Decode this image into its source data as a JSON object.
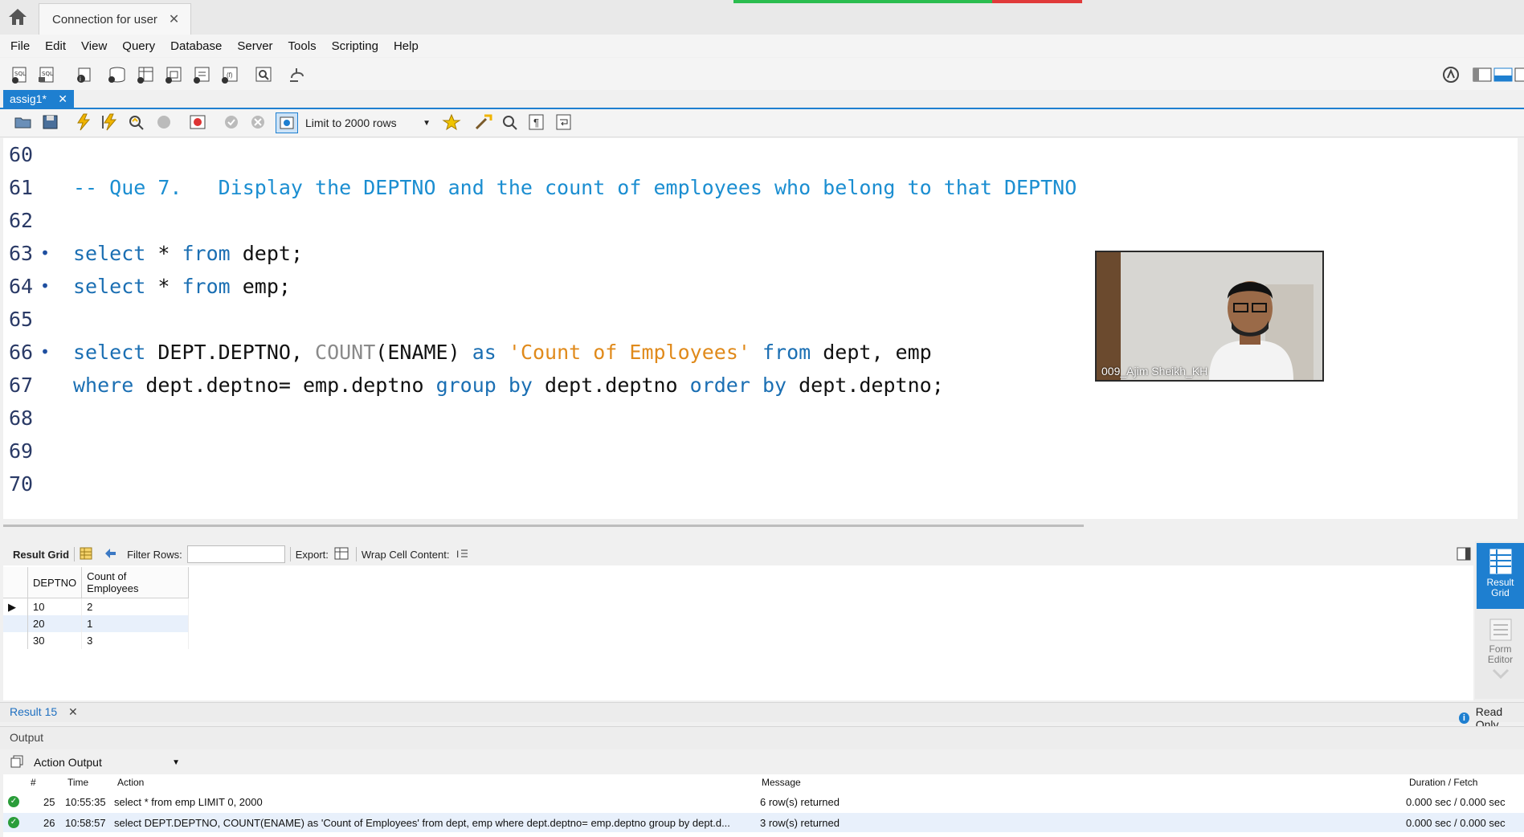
{
  "tabs": {
    "connection": "Connection for user",
    "file": "assig1*"
  },
  "menu": [
    "File",
    "Edit",
    "View",
    "Query",
    "Database",
    "Server",
    "Tools",
    "Scripting",
    "Help"
  ],
  "editor_toolbar": {
    "limit": "Limit to 2000 rows"
  },
  "editor_lines": [
    {
      "n": "60",
      "dot": false,
      "segs": []
    },
    {
      "n": "61",
      "dot": false,
      "segs": [
        {
          "t": "-- Que 7.   Display the DEPTNO and the count of employees who belong to that DEPTNO",
          "c": "cm"
        }
      ]
    },
    {
      "n": "62",
      "dot": false,
      "segs": []
    },
    {
      "n": "63",
      "dot": true,
      "segs": [
        {
          "t": "select",
          "c": "kw"
        },
        {
          "t": " * ",
          "c": "tx"
        },
        {
          "t": "from",
          "c": "kw"
        },
        {
          "t": " dept;",
          "c": "tx"
        }
      ]
    },
    {
      "n": "64",
      "dot": true,
      "segs": [
        {
          "t": "select",
          "c": "kw"
        },
        {
          "t": " * ",
          "c": "tx"
        },
        {
          "t": "from",
          "c": "kw"
        },
        {
          "t": " emp;",
          "c": "tx"
        }
      ]
    },
    {
      "n": "65",
      "dot": false,
      "segs": []
    },
    {
      "n": "66",
      "dot": true,
      "segs": [
        {
          "t": "select",
          "c": "kw"
        },
        {
          "t": " DEPT.DEPTNO, ",
          "c": "tx"
        },
        {
          "t": "COUNT",
          "c": "fn"
        },
        {
          "t": "(ENAME) ",
          "c": "tx"
        },
        {
          "t": "as",
          "c": "kw"
        },
        {
          "t": " ",
          "c": "tx"
        },
        {
          "t": "'Count of Employees'",
          "c": "str"
        },
        {
          "t": " ",
          "c": "tx"
        },
        {
          "t": "from",
          "c": "kw"
        },
        {
          "t": " dept, emp",
          "c": "tx"
        }
      ]
    },
    {
      "n": "67",
      "dot": false,
      "segs": [
        {
          "t": "where",
          "c": "kw"
        },
        {
          "t": " dept.deptno= emp.deptno ",
          "c": "tx"
        },
        {
          "t": "group by",
          "c": "kw"
        },
        {
          "t": " dept.deptno ",
          "c": "tx"
        },
        {
          "t": "order by",
          "c": "kw"
        },
        {
          "t": " dept.deptno;",
          "c": "tx"
        }
      ]
    },
    {
      "n": "68",
      "dot": false,
      "segs": []
    },
    {
      "n": "69",
      "dot": false,
      "segs": []
    },
    {
      "n": "70",
      "dot": false,
      "segs": []
    }
  ],
  "webcam": {
    "name": "009_Ajim Sheikh_KH"
  },
  "result_toolbar": {
    "result_grid": "Result Grid",
    "filter_rows": "Filter Rows:",
    "export": "Export:",
    "wrap": "Wrap Cell Content:"
  },
  "result_grid": {
    "columns": [
      "DEPTNO",
      "Count of\nEmployees"
    ],
    "rows": [
      [
        "10",
        "2"
      ],
      [
        "20",
        "1"
      ],
      [
        "30",
        "3"
      ]
    ]
  },
  "side_panel": {
    "result_grid": "Result Grid",
    "form_editor": "Form Editor"
  },
  "result_tab": {
    "label": "Result 15",
    "readonly": "Read Only"
  },
  "output": {
    "title": "Output",
    "selector": "Action Output",
    "headers": {
      "num": "#",
      "time": "Time",
      "action": "Action",
      "message": "Message",
      "duration": "Duration / Fetch"
    },
    "rows": [
      {
        "num": "25",
        "time": "10:55:35",
        "action": "select * from emp LIMIT 0, 2000",
        "message": "6 row(s) returned",
        "duration": "0.000 sec / 0.000 sec"
      },
      {
        "num": "26",
        "time": "10:58:57",
        "action": "select DEPT.DEPTNO, COUNT(ENAME) as 'Count of Employees' from dept, emp  where dept.deptno= emp.deptno group by dept.d...",
        "message": "3 row(s) returned",
        "duration": "0.000 sec / 0.000 sec"
      }
    ]
  }
}
